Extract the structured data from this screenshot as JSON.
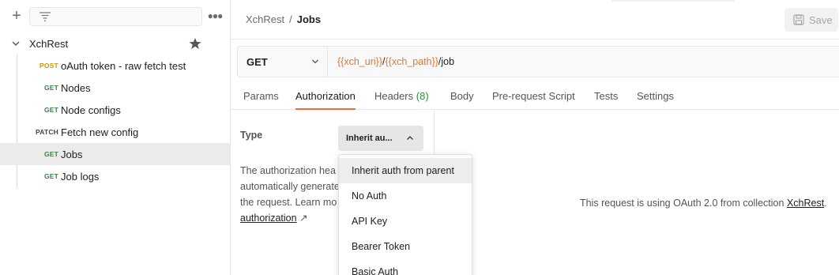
{
  "sidebar": {
    "collection": {
      "name": "XchRest"
    },
    "requests": [
      {
        "method": "POST",
        "name": "oAuth token - raw fetch test"
      },
      {
        "method": "GET",
        "name": "Nodes"
      },
      {
        "method": "GET",
        "name": "Node configs"
      },
      {
        "method": "PATCH",
        "name": "Fetch new config"
      },
      {
        "method": "GET",
        "name": "Jobs"
      },
      {
        "method": "GET",
        "name": "Job logs"
      }
    ]
  },
  "header": {
    "breadcrumb": {
      "parent": "XchRest",
      "separator": "/",
      "current": "Jobs"
    },
    "save_label": "Save"
  },
  "request": {
    "method": "GET",
    "url": {
      "var1": "{{xch_uri}}",
      "slash": "/",
      "var2": "{{xch_path}}",
      "path": "/job"
    }
  },
  "tabs": {
    "params": "Params",
    "authorization": "Authorization",
    "headers": "Headers",
    "headers_count": "(8)",
    "body": "Body",
    "prerequest": "Pre-request Script",
    "tests": "Tests",
    "settings": "Settings"
  },
  "auth": {
    "type_label": "Type",
    "selected": "Inherit au...",
    "desc_line1": "The authorization hea",
    "desc_line2": "automatically generate",
    "desc_line3": "the request. Learn mo",
    "desc_link": "authorization",
    "desc_link_arrow": "↗",
    "message_prefix": "This request is using OAuth 2.0 from collection ",
    "message_link": "XchRest",
    "message_suffix": "."
  },
  "menu": {
    "items": [
      "Inherit auth from parent",
      "No Auth",
      "API Key",
      "Bearer Token",
      "Basic Auth"
    ]
  },
  "colors": {
    "get": "#2d8a3e",
    "post": "#ce9500",
    "accent": "#f26b3a",
    "variable": "#e8742b"
  }
}
